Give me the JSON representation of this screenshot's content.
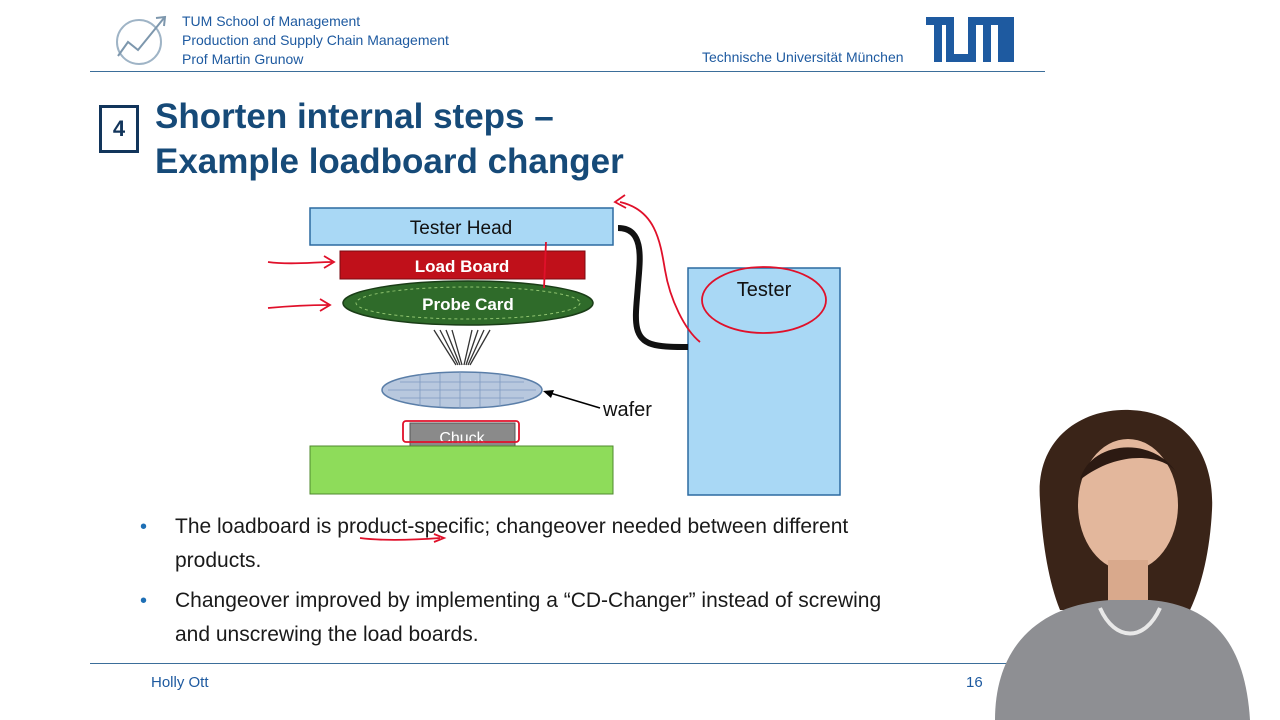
{
  "header": {
    "school": "TUM School of Management",
    "chair": "Production and Supply Chain Management",
    "professor": "Prof Martin Grunow",
    "university": "Technische Universität München",
    "brand_color": "#1e5aa0"
  },
  "slide": {
    "number": "4",
    "title_line1": "Shorten internal steps –",
    "title_line2": "Example loadboard changer"
  },
  "diagram": {
    "tester_head": "Tester Head",
    "load_board": "Load Board",
    "probe_card": "Probe Card",
    "wafer": "wafer",
    "chuck": "Chuck",
    "tester": "Tester"
  },
  "bullets": [
    "The loadboard is product-specific; changeover needed between different products.",
    "Changeover improved by implementing a “CD-Changer” instead of screwing and unscrewing the load boards."
  ],
  "footer": {
    "name": "Holly Ott",
    "page": "16"
  }
}
